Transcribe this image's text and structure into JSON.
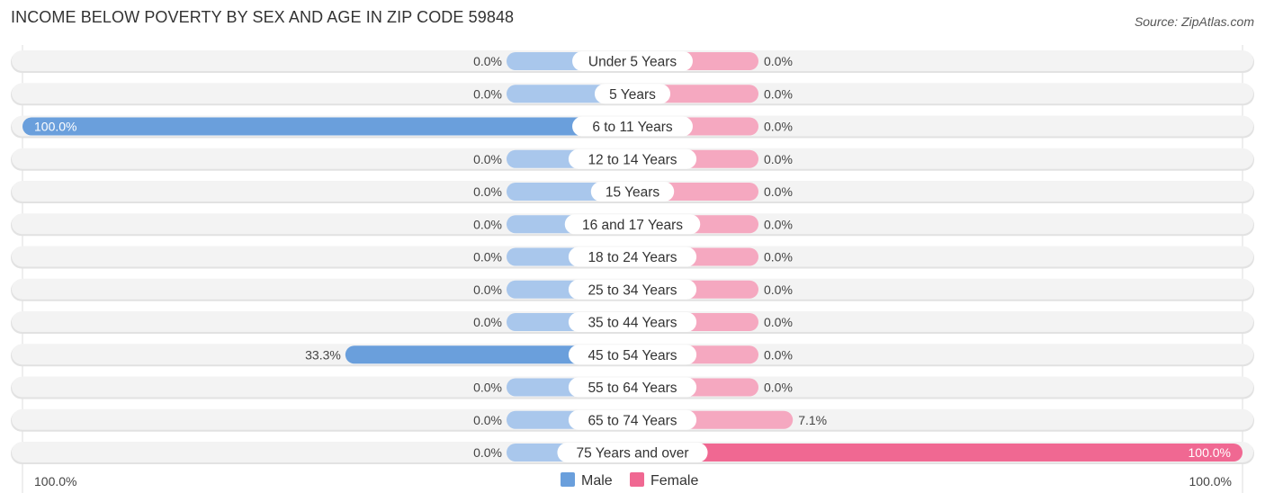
{
  "chart_data": {
    "type": "bar",
    "orientation": "horizontal-diverging",
    "title": "INCOME BELOW POVERTY BY SEX AND AGE IN ZIP CODE 59848",
    "source": "Source: ZipAtlas.com",
    "categories": [
      "Under 5 Years",
      "5 Years",
      "6 to 11 Years",
      "12 to 14 Years",
      "15 Years",
      "16 and 17 Years",
      "18 to 24 Years",
      "25 to 34 Years",
      "35 to 44 Years",
      "45 to 54 Years",
      "55 to 64 Years",
      "65 to 74 Years",
      "75 Years and over"
    ],
    "series": [
      {
        "name": "Male",
        "color": "#6a9fdc",
        "light_color": "#a9c7ec",
        "values": [
          0.0,
          0.0,
          100.0,
          0.0,
          0.0,
          0.0,
          0.0,
          0.0,
          0.0,
          33.3,
          0.0,
          0.0,
          0.0
        ],
        "labels": [
          "0.0%",
          "0.0%",
          "100.0%",
          "0.0%",
          "0.0%",
          "0.0%",
          "0.0%",
          "0.0%",
          "0.0%",
          "33.3%",
          "0.0%",
          "0.0%",
          "0.0%"
        ]
      },
      {
        "name": "Female",
        "color": "#f06892",
        "light_color": "#f5a8c0",
        "values": [
          0.0,
          0.0,
          0.0,
          0.0,
          0.0,
          0.0,
          0.0,
          0.0,
          0.0,
          0.0,
          0.0,
          7.1,
          100.0
        ],
        "labels": [
          "0.0%",
          "0.0%",
          "0.0%",
          "0.0%",
          "0.0%",
          "0.0%",
          "0.0%",
          "0.0%",
          "0.0%",
          "0.0%",
          "0.0%",
          "7.1%",
          "100.0%"
        ]
      }
    ],
    "axis": {
      "left_label": "100.0%",
      "right_label": "100.0%",
      "range": [
        0,
        100
      ]
    },
    "legend": {
      "position": "bottom-center",
      "items": [
        "Male",
        "Female"
      ]
    }
  }
}
